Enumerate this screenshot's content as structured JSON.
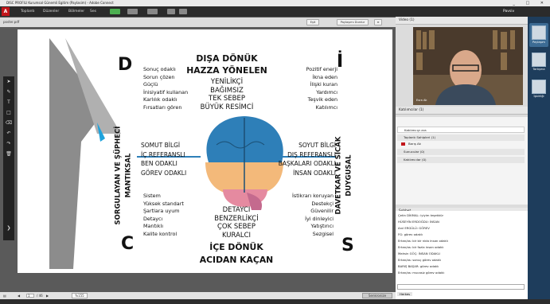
{
  "window": {
    "title": "DISC PROFILI Kurumsal Günemli Egitim (Paylasim) - Adobe Connect",
    "controls": "_ □ ✕"
  },
  "menubar": {
    "logo": "A",
    "items": [
      "Toplantı",
      "Düzenler",
      "Bölmeler",
      "Ses"
    ],
    "right_label": "Pavsiv"
  },
  "doc": {
    "filename": "poster.pdf",
    "sync_label": "Eşit",
    "share_label": "Paylaşımı Durdur"
  },
  "tool_icons": [
    "arrow-icon",
    "pen-icon",
    "text-icon",
    "shape-icon",
    "eraser-icon",
    "undo-icon",
    "redo-icon",
    "trash-icon",
    "menu-icon"
  ],
  "slide": {
    "letters": {
      "tl": "D",
      "tr": "İ",
      "bl": "C",
      "br": "S"
    },
    "top_title_1": "DIŞA DÖNÜK",
    "top_title_2": "HAZZA YÖNELEN",
    "bottom_title_1": "İÇE DÖNÜK",
    "bottom_title_2": "ACIDAN KAÇAN",
    "top_center": [
      "YENİLİKÇİ",
      "BAĞIMSIZ",
      "TEK SEBEP",
      "BÜYÜK RESİMCİ"
    ],
    "bottom_center": [
      "DETAYCI",
      "BENZERLİKÇİ",
      "ÇOK SEBEP",
      "KURALCI"
    ],
    "left_mid": [
      "SOMUT BİLGİ",
      "İÇ REFERANSLI",
      "BEN ODAKLI",
      "GÖREV ODAKLI"
    ],
    "right_mid": [
      "SOYUT BİLGİ",
      "DIŞ REFERANSLI",
      "BAŞKALARI ODAKLI",
      "İNSAN ODAKLI"
    ],
    "tl_list": [
      "Sonuç odaklı",
      "Sorun çözen",
      "Güçlü",
      "İnisiyatif kullanan",
      "Karlılık odaklı",
      "Fırsatları gören"
    ],
    "tr_list": [
      "Pozitif enerji",
      "İkna eden",
      "İlişki kuran",
      "Yardımcı",
      "Teşvik eden",
      "Katılımcı"
    ],
    "bl_list": [
      "Sistem",
      "Yüksek standart",
      "Şartlara uyum",
      "Detaycı",
      "Mantıklı",
      "Kalite kontrol"
    ],
    "br_list": [
      "İstikrarı koruyan",
      "Destekçi",
      "Güvenilir",
      "İyi dinleyici",
      "Yatıştırıcı",
      "Sezgisel"
    ],
    "left_vertical_1": "SORGULAYAN VE ŞÜPHECİ",
    "left_vertical_2": "MANTIKSAL",
    "right_vertical_1": "DAVETKAR VE SICAK",
    "right_vertical_2": "DUYGUSAL"
  },
  "bottombar": {
    "page": "1",
    "of": "/ 46",
    "zoom": "%155",
    "right_btn": "Senkronize"
  },
  "video": {
    "title": "Video (1)",
    "name": "Esra Ak"
  },
  "attendees": {
    "title": "Katılımcılar (1)",
    "search": "Katılımcıyı ara",
    "groups": [
      {
        "label": "Toplantı Sahipleri (1)",
        "members": [
          "Barış Ak"
        ]
      },
      {
        "label": "Sunucular (0)",
        "members": []
      },
      {
        "label": "Katılımcılar (0)",
        "members": []
      }
    ]
  },
  "chat": {
    "title": "Sohbet",
    "tab": "Herkes",
    "lines": [
      "Çetin DİKMAL: iyiyim teşekkür",
      "HÜSEYİN ERDOĞDU: İNSAN",
      "Anıl ERGÜLÜ: GÖREV",
      "FG: görev odaklı",
      "Ertan/as: bir bir nida insan odaklı",
      "Ertan/as: bir fazla insan odaklı",
      "Mahsin GÖÇ: İNSAN ODAKLI",
      "Ertan/as: sonuç görev odaklı",
      "BARIŞ BAŞAR: görev odaklı",
      "Ertan/as: mucasiz görev odaklı"
    ]
  },
  "layouts": [
    "Paylaşım",
    "Tartışma",
    "İşbirliği"
  ],
  "colors": {
    "accent": "#1e3d5c",
    "brand_red": "#c2161b",
    "brain_blue": "#2e7fb8",
    "brain_orange": "#f3b97a",
    "brain_pink": "#e58aa0"
  }
}
